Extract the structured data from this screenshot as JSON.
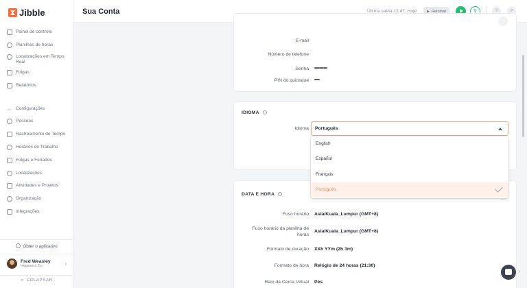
{
  "app": {
    "name": "Jibble"
  },
  "sidebar": {
    "items": [
      {
        "label": "Painel de controle",
        "icon": "dashboard-icon"
      },
      {
        "label": "Planilhas de horas",
        "icon": "clock-icon"
      },
      {
        "label": "Localizações em Tempo Real",
        "icon": "location-icon"
      },
      {
        "label": "Folgas",
        "icon": "suitcase-icon"
      },
      {
        "label": "Relatórios",
        "icon": "report-icon"
      }
    ],
    "settings_label": "Configurações",
    "settings_items": [
      {
        "label": "Pessoas",
        "icon": "people-icon"
      },
      {
        "label": "Rastreamento de Tempo",
        "icon": "tracking-icon"
      },
      {
        "label": "Horários de Trabalho",
        "icon": "schedule-icon"
      },
      {
        "label": "Folgas e Feriados",
        "icon": "holiday-icon"
      },
      {
        "label": "Localizações",
        "icon": "pin-icon"
      },
      {
        "label": "Atividades e Projetos",
        "icon": "tag-icon"
      },
      {
        "label": "Organização",
        "icon": "org-icon"
      },
      {
        "label": "Integrações",
        "icon": "plug-icon"
      }
    ],
    "get_app": "Obter o aplicativo",
    "user": {
      "name": "Fred Weasley",
      "org": "Hogwarts Co"
    },
    "collapse": "COLAPSAR"
  },
  "header": {
    "title": "Sua Conta",
    "last_out": "Última saída 12:47, Hoje",
    "resume": "Retomar"
  },
  "account": {
    "rows": [
      {
        "label": "E-mail",
        "value": ""
      },
      {
        "label": "Número de telefone",
        "value": ""
      },
      {
        "label": "Senha",
        "value": "••••••••••"
      },
      {
        "label": "PIN do quiosque",
        "value": "••••"
      }
    ]
  },
  "language": {
    "section_title": "IDIOMA",
    "field_label": "Idioma",
    "selected": "Português",
    "options": [
      "English",
      "Español",
      "Français",
      "Português"
    ]
  },
  "datetime": {
    "section_title": "DATA E HORA",
    "rows": [
      {
        "label": "Fuso horário",
        "value": "Asia/Kuala_Lumpur (GMT+8)"
      },
      {
        "label": "Fuso horário da planilha de horas",
        "value": "Asia/Kuala_Lumpur (GMT+8)"
      },
      {
        "label": "Formato de duração",
        "value": "XXh YYm (2h 3m)"
      },
      {
        "label": "Formato de hora",
        "value": "Relógio de 24 horas (21:30)"
      },
      {
        "label": "Raio da Cerca Virtual",
        "value": "Pés"
      }
    ]
  },
  "colors": {
    "accent": "#ff6a3d",
    "green": "#1fbf6b",
    "selected_bg": "#fff1ea"
  }
}
